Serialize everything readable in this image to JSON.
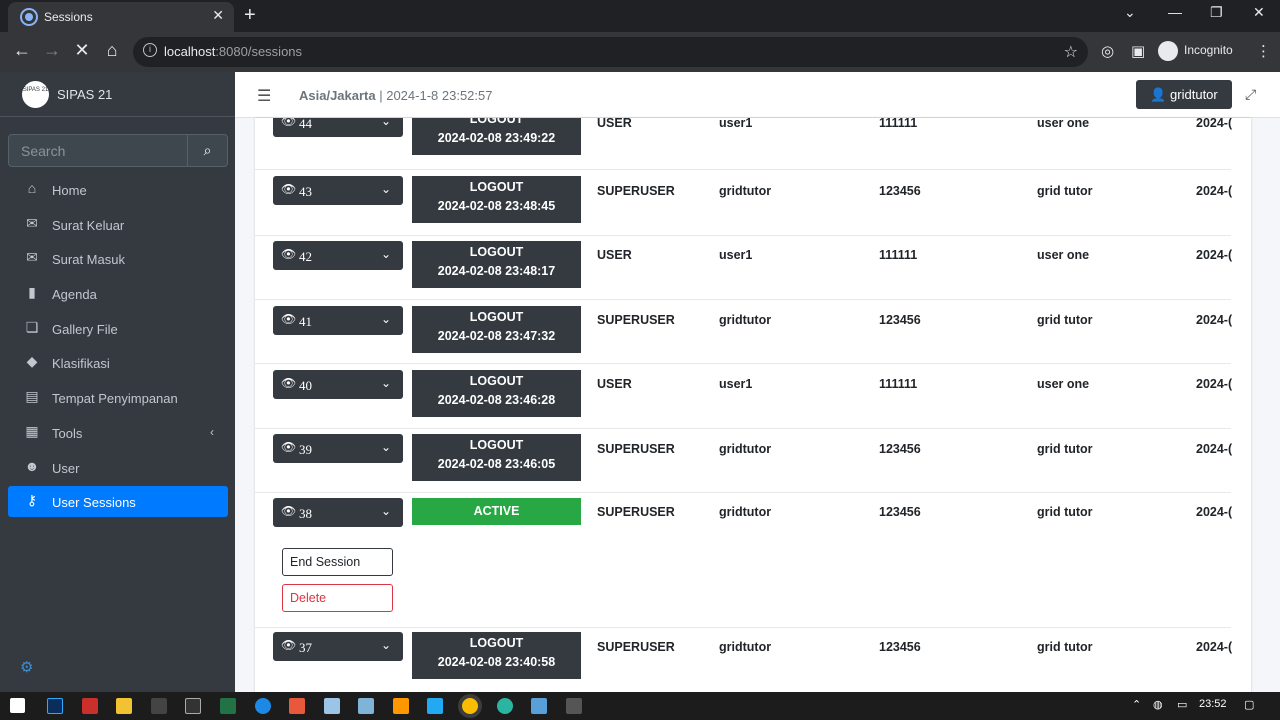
{
  "browser": {
    "tab_title": "Sessions",
    "url_host": "localhost",
    "url_rest": ":8080/sessions",
    "profile": "Incognito",
    "new_tab_symbol": "+",
    "close_symbol": "✕"
  },
  "app": {
    "brand_logo_text": "SIPAS 21",
    "brand_name": "SIPAS 21",
    "search_placeholder": "Search",
    "timezone": "Asia/Jakarta",
    "datetime": " | 2024-1-8 23:52:57",
    "user_button": "gridtutor",
    "accent": "#007bff"
  },
  "sidebar": {
    "items": [
      {
        "label": "Home",
        "icon": "home-icon"
      },
      {
        "label": "Surat Keluar",
        "icon": "envelope-icon"
      },
      {
        "label": "Surat Masuk",
        "icon": "envelope-icon"
      },
      {
        "label": "Agenda",
        "icon": "book-icon"
      },
      {
        "label": "Gallery File",
        "icon": "copy-icon"
      },
      {
        "label": "Klasifikasi",
        "icon": "tags-icon"
      },
      {
        "label": "Tempat Penyimpanan",
        "icon": "box-icon"
      },
      {
        "label": "Tools",
        "icon": "th-icon"
      },
      {
        "label": "User",
        "icon": "users-icon"
      },
      {
        "label": "User Sessions",
        "icon": "key-icon"
      }
    ]
  },
  "sessions": [
    {
      "id": "44",
      "status": "LOGOUT",
      "time": "2024-02-08 23:49:22",
      "role": "USER",
      "username": "user1",
      "pin": "111111",
      "name": "user one",
      "date": "2024-("
    },
    {
      "id": "43",
      "status": "LOGOUT",
      "time": "2024-02-08 23:48:45",
      "role": "SUPERUSER",
      "username": "gridtutor",
      "pin": "123456",
      "name": "grid tutor",
      "date": "2024-("
    },
    {
      "id": "42",
      "status": "LOGOUT",
      "time": "2024-02-08 23:48:17",
      "role": "USER",
      "username": "user1",
      "pin": "111111",
      "name": "user one",
      "date": "2024-("
    },
    {
      "id": "41",
      "status": "LOGOUT",
      "time": "2024-02-08 23:47:32",
      "role": "SUPERUSER",
      "username": "gridtutor",
      "pin": "123456",
      "name": "grid tutor",
      "date": "2024-("
    },
    {
      "id": "40",
      "status": "LOGOUT",
      "time": "2024-02-08 23:46:28",
      "role": "USER",
      "username": "user1",
      "pin": "111111",
      "name": "user one",
      "date": "2024-("
    },
    {
      "id": "39",
      "status": "LOGOUT",
      "time": "2024-02-08 23:46:05",
      "role": "SUPERUSER",
      "username": "gridtutor",
      "pin": "123456",
      "name": "grid tutor",
      "date": "2024-("
    },
    {
      "id": "38",
      "status": "ACTIVE",
      "time": "",
      "role": "SUPERUSER",
      "username": "gridtutor",
      "pin": "123456",
      "name": "grid tutor",
      "date": "2024-("
    },
    {
      "id": "37",
      "status": "LOGOUT",
      "time": "2024-02-08 23:40:58",
      "role": "SUPERUSER",
      "username": "gridtutor",
      "pin": "123456",
      "name": "grid tutor",
      "date": "2024-("
    }
  ],
  "actions": {
    "end_session": "End Session",
    "delete": "Delete"
  },
  "taskbar": {
    "clock": "23:52"
  }
}
